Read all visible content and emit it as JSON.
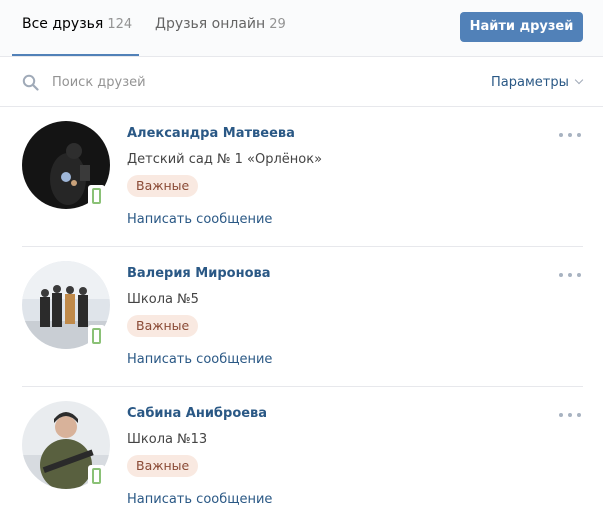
{
  "tabs": [
    {
      "label": "Все друзья",
      "count": "124"
    },
    {
      "label": "Друзья онлайн",
      "count": "29"
    }
  ],
  "find_button": "Найти друзей",
  "search": {
    "placeholder": "Поиск друзей",
    "value": ""
  },
  "params_label": "Параметры",
  "friends": [
    {
      "name": "Александра Матвеева",
      "subtitle": "Детский сад № 1 «Орлёнок»",
      "badge": "Важные",
      "message_link": "Написать сообщение",
      "online": "mobile"
    },
    {
      "name": "Валерия Миронова",
      "subtitle": "Школа №5",
      "badge": "Важные",
      "message_link": "Написать сообщение",
      "online": "mobile"
    },
    {
      "name": "Сабина Аниброева",
      "subtitle": "Школа №13",
      "badge": "Важные",
      "message_link": "Написать сообщение",
      "online": "mobile"
    }
  ],
  "colors": {
    "accent": "#5181b8",
    "link": "#2a5885",
    "badge_bg": "#f9e9e1",
    "online": "#8ac176"
  }
}
